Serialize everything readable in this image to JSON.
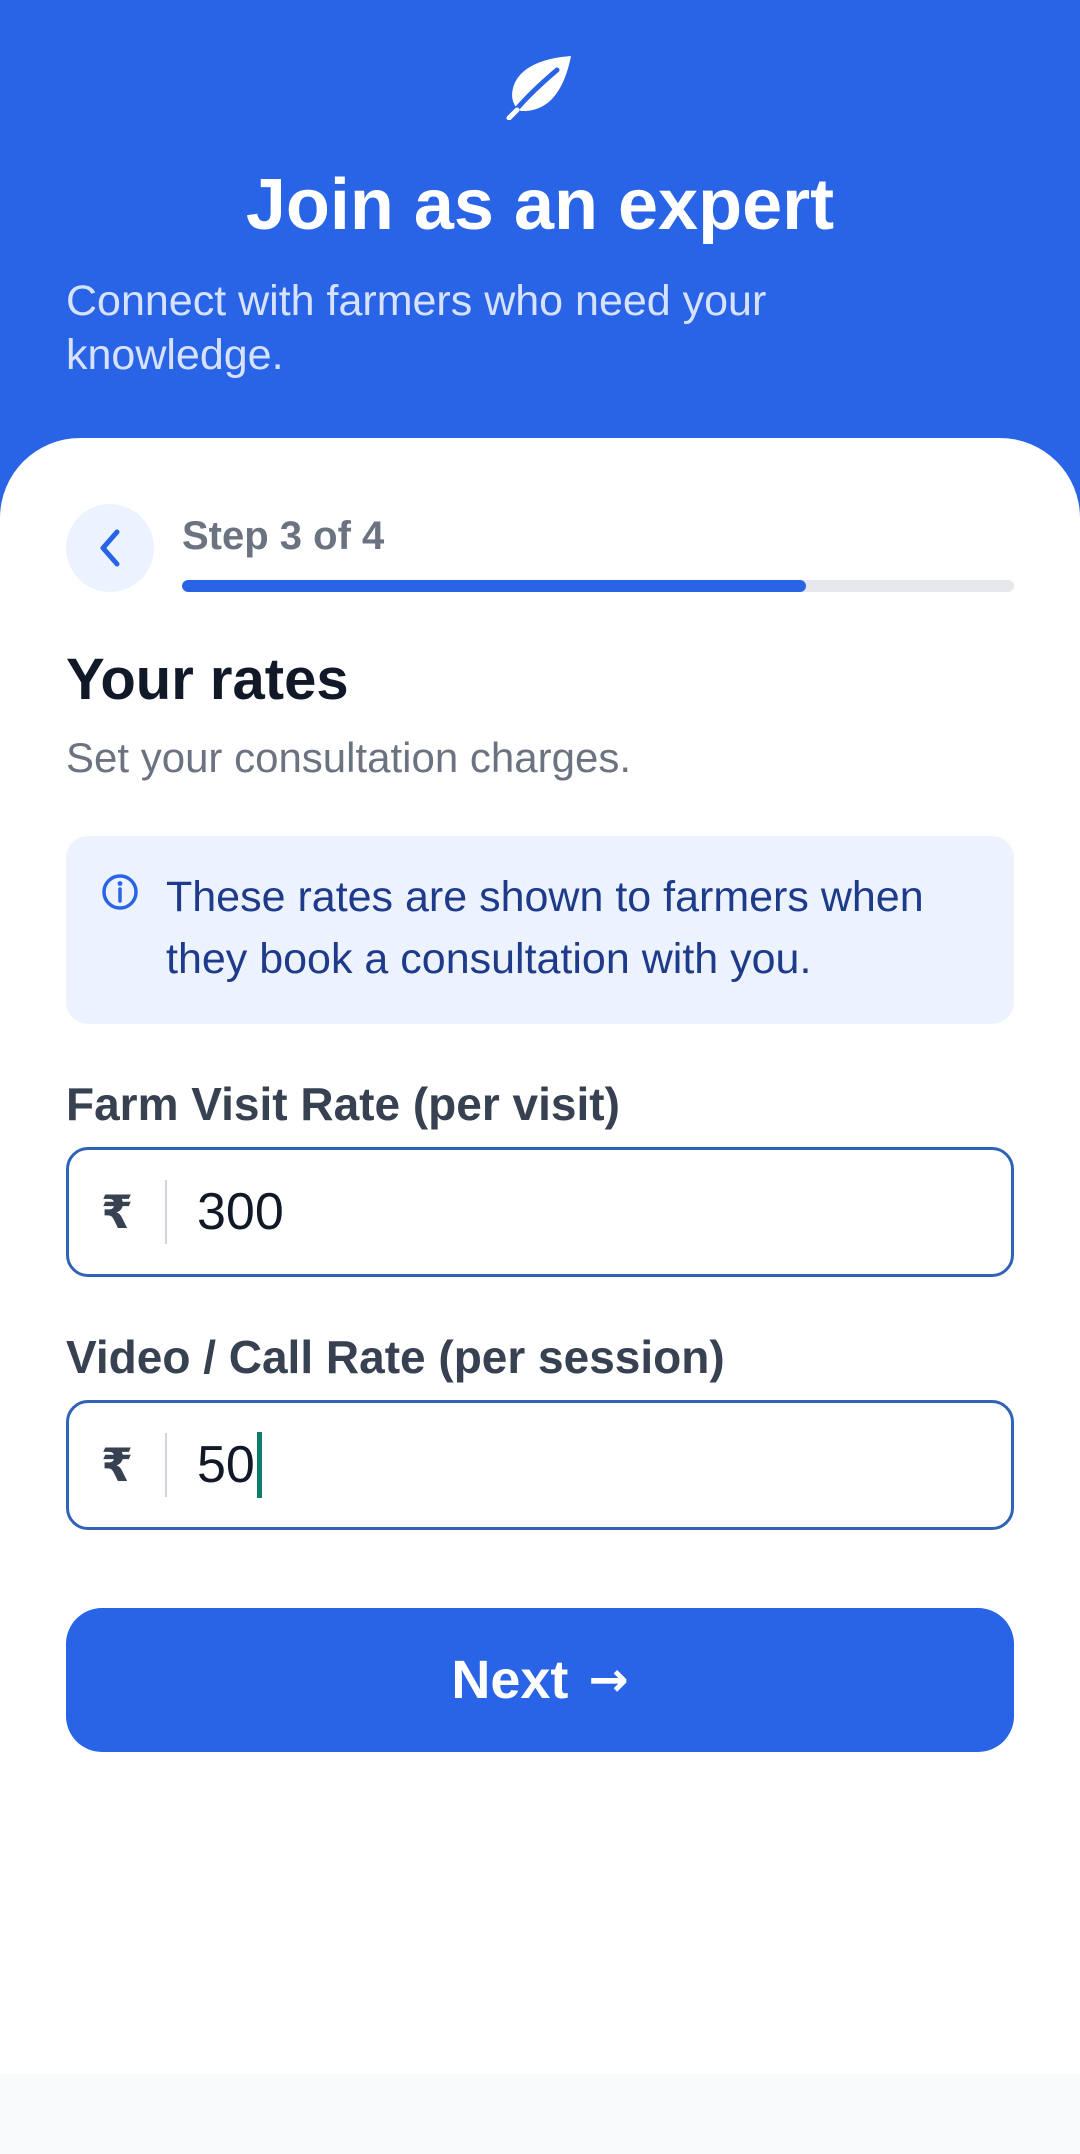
{
  "header": {
    "title": "Join as an expert",
    "subtitle": "Connect with farmers who need your knowledge.",
    "logo_icon": "leaf-icon",
    "background_color": "#2964e6"
  },
  "stepper": {
    "back_icon": "chevron-left-icon",
    "label": "Step 3 of 4",
    "current_step": 3,
    "total_steps": 4,
    "progress_fraction": 0.75
  },
  "section": {
    "title": "Your rates",
    "subtitle": "Set your consultation charges."
  },
  "info": {
    "icon": "info-icon",
    "text": "These rates are shown to farmers when they book a consultation with you."
  },
  "fields": {
    "farm_visit": {
      "label": "Farm Visit Rate (per visit)",
      "currency": "₹",
      "value": "300"
    },
    "video_call": {
      "label": "Video / Call Rate (per session)",
      "currency": "₹",
      "value": "50"
    }
  },
  "actions": {
    "next_label": "Next",
    "next_arrow": "→"
  },
  "colors": {
    "primary": "#2964e6",
    "info_background": "#edf3fe",
    "field_border": "#3063b8",
    "caret": "#0f7b6c"
  }
}
